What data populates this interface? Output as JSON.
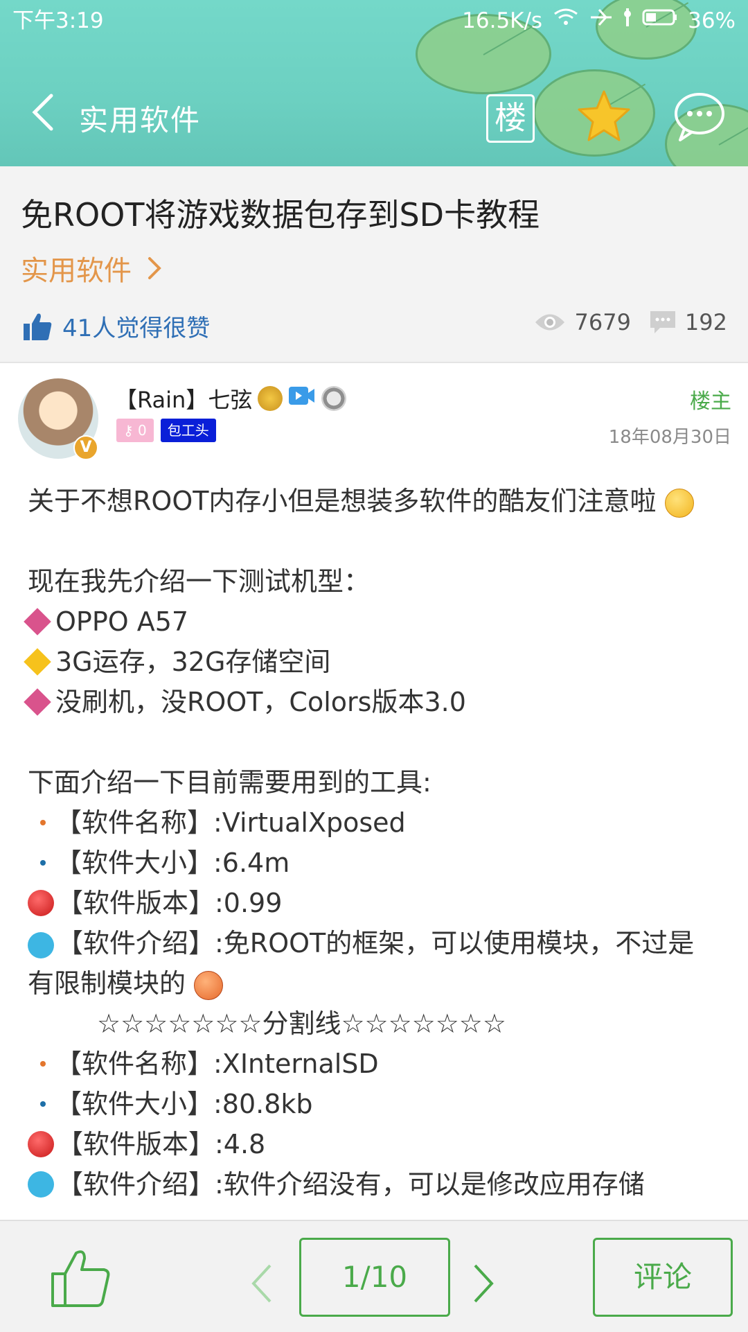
{
  "status_bar": {
    "time": "下午3:19",
    "speed": "16.5K/s",
    "battery": "36%"
  },
  "header": {
    "title": "实用软件",
    "floor_label": "楼"
  },
  "thread": {
    "title": "免ROOT将游戏数据包存到SD卡教程",
    "category": "实用软件",
    "likes_text": "41人觉得很赞",
    "views": "7679",
    "comments": "192"
  },
  "post": {
    "username": "【Rain】七弦",
    "badge_letter": "V",
    "level": "0",
    "title_tag": "包工头",
    "op_label": "楼主",
    "date": "18年08月30日",
    "lines": {
      "intro": "关于不想ROOT内存小但是想装多软件的酷友们注意啦",
      "model_heading": "现在我先介绍一下测试机型：",
      "model_1": "OPPO A57",
      "model_2": "3G运存，32G存储空间",
      "model_3": "没刷机，没ROOT，Colors版本3.0",
      "tools_heading": "下面介绍一下目前需要用到的工具:",
      "t1_name": "【软件名称】:VirtualXposed",
      "t1_size": "【软件大小】:6.4m",
      "t1_ver": "【软件版本】:0.99",
      "t1_desc": "【软件介绍】:免ROOT的框架，可以使用模块，不过是有限制模块的",
      "divider": "☆☆☆☆☆☆☆分割线☆☆☆☆☆☆☆",
      "t2_name": "【软件名称】:XInternalSD",
      "t2_size": "【软件大小】:80.8kb",
      "t2_ver": "【软件版本】:4.8",
      "t2_desc": "【软件介绍】:软件介绍没有，可以是修改应用存储"
    }
  },
  "bottom_bar": {
    "page": "1/10",
    "comment_label": "评论"
  },
  "colors": {
    "accent_green": "#4aaa4a",
    "header_teal": "#6cd0c1",
    "category_orange": "#e3964a",
    "like_blue": "#2f6fb5"
  }
}
